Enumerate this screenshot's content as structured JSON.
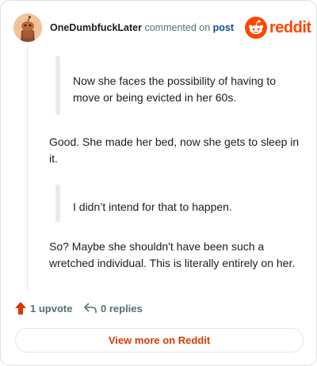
{
  "header": {
    "author": "OneDumbfuckLater",
    "action": "commented on",
    "link": "post",
    "avatar_icon": "snoo-avatar-icon",
    "logo_text": "reddit",
    "logo_icon": "reddit-logo-icon",
    "brand_color": "#ff4500"
  },
  "comment": {
    "quote1": "Now she faces the possibility of having to move or being evicted in her 60s.",
    "para1": "Good. She made her bed, now she gets to sleep in it.",
    "quote2": "I didn’t intend for that to happen.",
    "para2": "So? Maybe she shouldn't have been such a wretched individual. This is literally entirely on her."
  },
  "footer": {
    "upvotes": "1 upvote",
    "upvote_icon": "upvote-arrow-icon",
    "replies": "0 replies",
    "reply_icon": "reply-arrow-icon",
    "view_more": "View more on Reddit"
  }
}
